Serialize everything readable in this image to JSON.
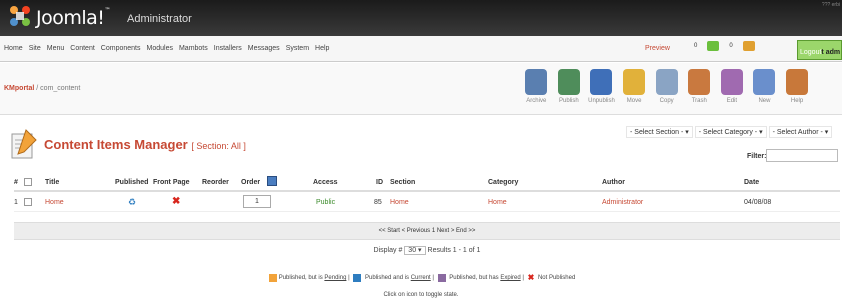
{
  "header": {
    "logo_text": "Joomla!",
    "logo_tm": "™",
    "subtitle": "Administrator",
    "version": "???\nerbi"
  },
  "menu": [
    "Home",
    "Site",
    "Menu",
    "Content",
    "Components",
    "Modules",
    "Mambots",
    "Installers",
    "Messages",
    "System",
    "Help"
  ],
  "status": {
    "preview": "Preview",
    "messages_count": "0",
    "users_count": "0",
    "logout": "Logout",
    "user": "t adm"
  },
  "breadcrumb": {
    "home": "KMportal",
    "path": " / com_content"
  },
  "toolbar": [
    {
      "label": "Archive",
      "color": "#5a7fb0"
    },
    {
      "label": "Publish",
      "color": "#4f8d5b"
    },
    {
      "label": "Unpublish",
      "color": "#3f6fb8"
    },
    {
      "label": "Move",
      "color": "#e1b13a"
    },
    {
      "label": "Copy",
      "color": "#8aa4c4"
    },
    {
      "label": "Trash",
      "color": "#c9793f"
    },
    {
      "label": "Edit",
      "color": "#a06ab0"
    },
    {
      "label": "New",
      "color": "#6a8fcc"
    },
    {
      "label": "Help",
      "color": "#c8783a"
    }
  ],
  "page": {
    "title": "Content Items Manager",
    "section": "[ Section: All ]",
    "filters": [
      "- Select Section -",
      "- Select Category -",
      "- Select Author -"
    ],
    "filter_label": "Filter:"
  },
  "table": {
    "headers": [
      "#",
      "Title",
      "Published",
      "Front Page",
      "Reorder",
      "Order",
      "Access",
      "ID",
      "Section",
      "Category",
      "Author",
      "Date"
    ],
    "rows": [
      {
        "num": "1",
        "title": "Home",
        "order": "1",
        "access": "Public",
        "id": "85",
        "section": "Home",
        "category": "Home",
        "author": "Administrator",
        "date": "04/08/08"
      }
    ]
  },
  "pager": "<< Start < Previous 1 Next > End >>",
  "display": {
    "label": "Display #",
    "value": "30",
    "results": "Results 1 - 1 of 1"
  },
  "legend": {
    "pending_pre": "Published, but is ",
    "pending": "Pending",
    "current_pre": " Published and is ",
    "current": "Current",
    "expired_pre": " Published, but has ",
    "expired": "Expired",
    "not_published": " Not Published"
  },
  "hint": "Click on icon to toggle state.",
  "colors": {
    "accent": "#c64934",
    "header": "#1b1b1b",
    "logout": "#9bd66b"
  }
}
